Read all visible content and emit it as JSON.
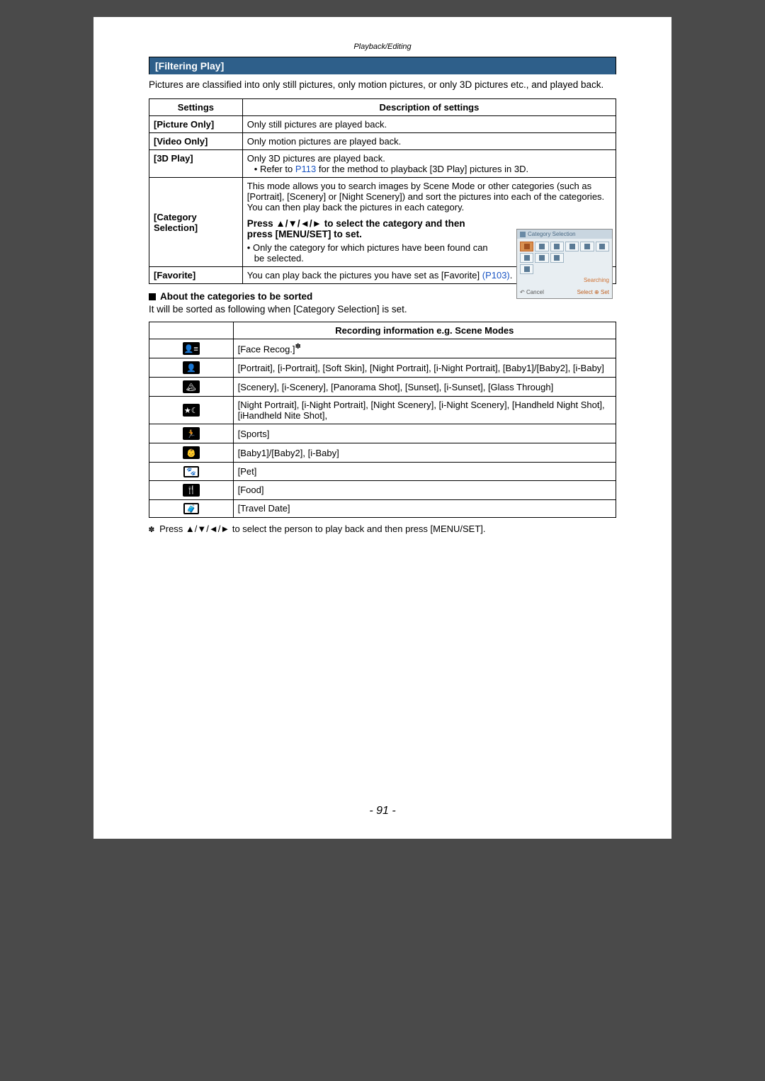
{
  "breadcrumb": "Playback/Editing",
  "section_title": "[Filtering Play]",
  "intro": "Pictures are classified into only still pictures, only motion pictures, or only 3D pictures etc., and played back.",
  "settings_table": {
    "head_settings": "Settings",
    "head_desc": "Description of settings",
    "rows": {
      "picture_only": {
        "label": "[Picture Only]",
        "desc": "Only still pictures are played back."
      },
      "video_only": {
        "label": "[Video Only]",
        "desc": "Only motion pictures are played back."
      },
      "three_d": {
        "label": "[3D Play]",
        "line1": "Only 3D pictures are played back.",
        "bullet_pre": "Refer to ",
        "bullet_link": "P113",
        "bullet_post": " for the method to playback [3D Play] pictures in 3D."
      },
      "category": {
        "label": "[Category Selection]",
        "desc": "This mode allows you to search images by Scene Mode or other categories (such as [Portrait], [Scenery] or [Night Scenery]) and sort the pictures into each of the categories. You can then play back the pictures in each category.",
        "press_pre": "Press ",
        "press_arrows": "▲/▼/◄/►",
        "press_mid": " to select the category and then press [MENU/SET] to set.",
        "bullet": "Only the category for which pictures have been found can be selected.",
        "screenshot": {
          "title": "Category Selection",
          "searching": "Searching",
          "cancel": "Cancel",
          "select": "Select",
          "set": "Set"
        }
      },
      "favorite": {
        "label": "[Favorite]",
        "desc_pre": "You can play back the pictures you have set as [Favorite] ",
        "link": "(P103)",
        "desc_post": "."
      }
    }
  },
  "about_heading": "About the categories to be sorted",
  "about_text": "It will be sorted as following when [Category Selection] is set.",
  "cat_table": {
    "head": "Recording information e.g. Scene Modes",
    "rows": [
      {
        "icon": "👤≡",
        "text_pre": "[Face Recog.]",
        "text_sup": "✽"
      },
      {
        "icon": "👤",
        "text": "[Portrait], [i-Portrait], [Soft Skin], [Night Portrait], [i-Night Portrait], [Baby1]/[Baby2], [i-Baby]"
      },
      {
        "icon": "🏔",
        "text": "[Scenery], [i-Scenery], [Panorama Shot], [Sunset], [i-Sunset], [Glass Through]"
      },
      {
        "icon": "★☾",
        "text": "[Night Portrait], [i-Night Portrait], [Night Scenery], [i-Night Scenery], [Handheld Night Shot], [iHandheld Nite Shot],"
      },
      {
        "icon": "🏃",
        "text": "[Sports]"
      },
      {
        "icon": "👶",
        "text": "[Baby1]/[Baby2], [i-Baby]"
      },
      {
        "icon": "🐾",
        "text": "[Pet]"
      },
      {
        "icon": "🍴",
        "text": "[Food]"
      },
      {
        "icon": "🧳",
        "text": "[Travel Date]"
      }
    ]
  },
  "footnote": {
    "mark": "✽",
    "pre": "Press ",
    "arrows": "▲/▼/◄/►",
    "post": " to select the person to play back and then press [MENU/SET]."
  },
  "page_number": "- 91 -"
}
